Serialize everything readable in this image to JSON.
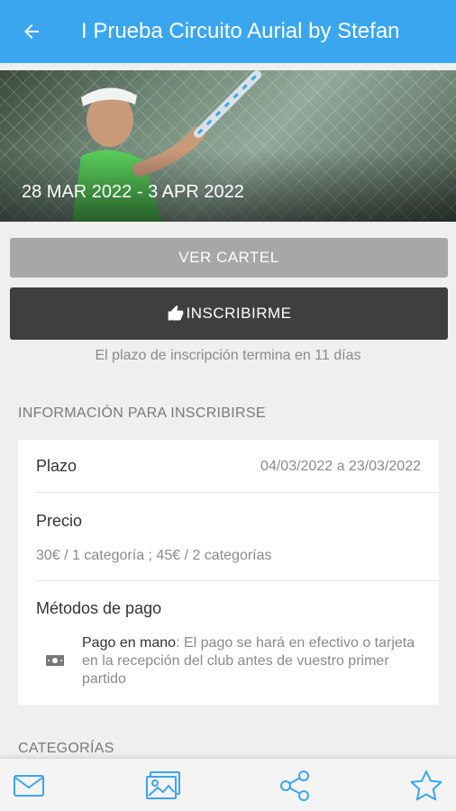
{
  "header": {
    "title": "I Prueba Circuito Aurial by Stefan"
  },
  "hero": {
    "dates": "28 MAR 2022 - 3 APR 2022"
  },
  "actions": {
    "cartel_label": "VER CARTEL",
    "inscribirme_label": "INSCRIBIRME"
  },
  "deadline_text": "El plazo de inscripción termina en 11 días",
  "info": {
    "section_title": "INFORMACIÓN PARA INSCRIBIRSE",
    "plazo_label": "Plazo",
    "plazo_value": "04/03/2022 a 23/03/2022",
    "precio_label": "Precio",
    "precio_value": "30€ / 1 categoría ; 45€ / 2 categorías",
    "metodos_label": "Métodos de pago",
    "pago_title": "Pago en mano",
    "pago_desc": ": El pago se hará en efectivo o tarjeta en la recepción del club antes de vuestro primer partido"
  },
  "categorias_title": "CATEGORÍAS",
  "icons": {
    "back": "arrow-left-icon",
    "like": "thumbs-up-icon",
    "cash": "banknote-icon",
    "mail": "mail-icon",
    "gallery": "gallery-icon",
    "share": "share-icon",
    "star": "star-icon"
  },
  "colors": {
    "primary": "#3aa6f0",
    "dark_button": "#3f3f3f",
    "gray_button": "#a7a7a7"
  }
}
